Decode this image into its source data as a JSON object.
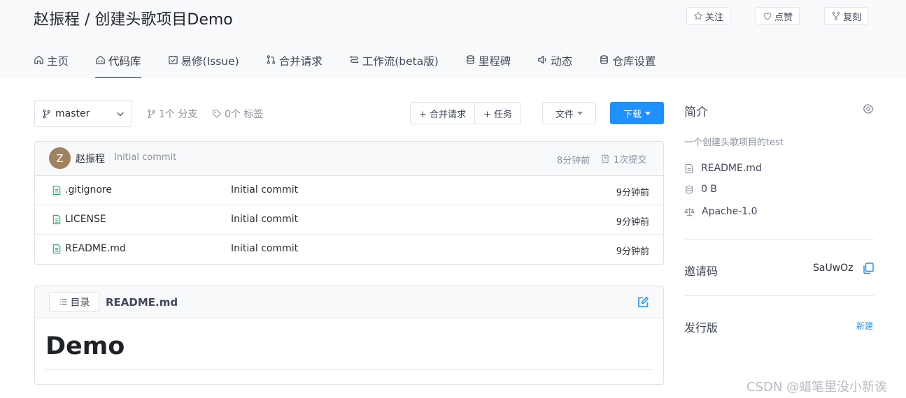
{
  "repo": {
    "title": "赵振程 / 创建头歌项目Demo",
    "actions": {
      "watch": "关注",
      "star": "点赞",
      "fork": "复刻"
    }
  },
  "nav": {
    "tabs": [
      {
        "label": "主页",
        "icon": "home-icon"
      },
      {
        "label": "代码库",
        "icon": "code-icon",
        "active": true
      },
      {
        "label": "易修(Issue)",
        "icon": "issue-icon"
      },
      {
        "label": "合并请求",
        "icon": "pull-request-icon"
      },
      {
        "label": "工作流(beta版)",
        "icon": "workflow-icon"
      },
      {
        "label": "里程碑",
        "icon": "milestone-icon"
      },
      {
        "label": "动态",
        "icon": "activity-icon"
      },
      {
        "label": "仓库设置",
        "icon": "settings-database-icon"
      }
    ]
  },
  "toolbar": {
    "branch": "master",
    "branches": "1个 分支",
    "tags": "0个 标签",
    "new_pr": "+ 合并请求",
    "new_task": "+ 任务",
    "file": "文件",
    "download": "下载"
  },
  "commit": {
    "avatar_letter": "Z",
    "author": "赵振程",
    "message": "Initial commit",
    "time": "8分钟前",
    "count": "1次提交"
  },
  "files": [
    {
      "name": ".gitignore",
      "commit": "Initial commit",
      "time": "9分钟前"
    },
    {
      "name": "LICENSE",
      "commit": "Initial commit",
      "time": "9分钟前"
    },
    {
      "name": "README.md",
      "commit": "Initial commit",
      "time": "9分钟前"
    }
  ],
  "readme": {
    "toc": "目录",
    "title": "README.md",
    "heading": "Demo"
  },
  "sidebar": {
    "title": "简介",
    "description": "一个创建头歌项目的test",
    "readme": "README.md",
    "size": "0 B",
    "license": "Apache-1.0",
    "invite_label": "邀请码",
    "invite_code": "SaUwOz",
    "release_label": "发行版",
    "release_new": "新建"
  },
  "watermark": "CSDN @蜡笔里没小新诶",
  "colors": {
    "accent": "#1e90ff",
    "avatar": "#a08161",
    "file_icon": "#27ae60"
  }
}
